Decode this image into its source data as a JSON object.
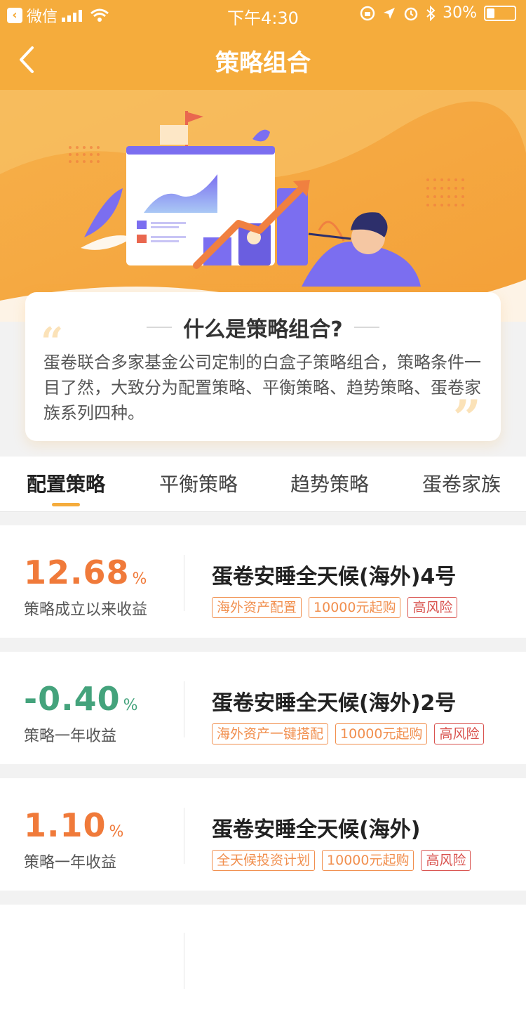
{
  "status_bar": {
    "app": "微信",
    "time": "下午4:30",
    "battery": "30%"
  },
  "nav": {
    "title": "策略组合"
  },
  "intro": {
    "title": "什么是策略组合?",
    "text": "蛋卷联合多家基金公司定制的白盒子策略组合，策略条件一目了然，大致分为配置策略、平衡策略、趋势策略、蛋卷家族系列四种。",
    "quote_open": "“",
    "quote_close": "”"
  },
  "tabs": [
    {
      "label": "配置策略",
      "active": true
    },
    {
      "label": "平衡策略",
      "active": false
    },
    {
      "label": "趋势策略",
      "active": false
    },
    {
      "label": "蛋卷家族",
      "active": false
    }
  ],
  "strategies": [
    {
      "rate": "12.68",
      "unit": "%",
      "rate_label": "策略成立以来收益",
      "name": "蛋卷安睡全天候(海外)4号",
      "tags": [
        "海外资产配置",
        "10000元起购",
        "高风险"
      ]
    },
    {
      "rate": "-0.40",
      "unit": "%",
      "rate_label": "策略一年收益",
      "name": "蛋卷安睡全天候(海外)2号",
      "tags": [
        "海外资产一键搭配",
        "10000元起购",
        "高风险"
      ]
    },
    {
      "rate": "1.10",
      "unit": "%",
      "rate_label": "策略一年收益",
      "name": "蛋卷安睡全天候(海外)",
      "tags": [
        "全天候投资计划",
        "10000元起购",
        "高风险"
      ]
    }
  ],
  "colors": {
    "brand": "#f5ac3c",
    "positive": "#f07a3a",
    "negative": "#44a37c",
    "risk": "#d9534f"
  }
}
